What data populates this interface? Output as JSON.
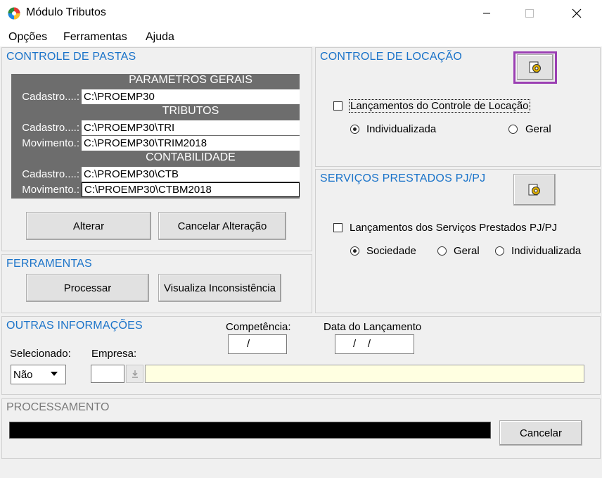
{
  "window": {
    "title": "Módulo Tributos"
  },
  "menu": {
    "items": [
      "Opções",
      "Ferramentas",
      "Ajuda"
    ]
  },
  "pastas": {
    "title": "CONTROLE DE PASTAS",
    "sections": [
      {
        "header": "PARAMETROS GERAIS",
        "rows": [
          {
            "label": "Cadastro....:",
            "path": "C:\\PROEMP30"
          }
        ]
      },
      {
        "header": "TRIBUTOS",
        "rows": [
          {
            "label": "Cadastro....:",
            "path": "C:\\PROEMP30\\TRI"
          },
          {
            "label": "Movimento.:",
            "path": "C:\\PROEMP30\\TRIM2018"
          }
        ]
      },
      {
        "header": "CONTABILIDADE",
        "rows": [
          {
            "label": "Cadastro....:",
            "path": "C:\\PROEMP30\\CTB"
          },
          {
            "label": "Movimento.:",
            "path": "C:\\PROEMP30\\CTBM2018"
          }
        ]
      }
    ],
    "alterar_label": "Alterar",
    "cancelar_alteracao_label": "Cancelar Alteração"
  },
  "ferramentas": {
    "title": "FERRAMENTAS",
    "processar_label": "Processar",
    "visualiza_label": "Visualiza Inconsistência"
  },
  "locacao": {
    "title": "CONTROLE DE LOCAÇÃO",
    "checkbox_label": "Lançamentos do Controle de Locação",
    "options": [
      "Individualizada",
      "Geral"
    ],
    "selected": "Individualizada"
  },
  "servicos": {
    "title": "SERVIÇOS PRESTADOS PJ/PJ",
    "checkbox_label": "Lançamentos dos Serviços Prestados PJ/PJ",
    "options": [
      "Sociedade",
      "Geral",
      "Individualizada"
    ],
    "selected": "Sociedade"
  },
  "outras": {
    "title": "OUTRAS INFORMAÇÕES",
    "competencia_label": "Competência:",
    "competencia_value": "/",
    "data_label": "Data do Lançamento",
    "data_value": "/    /",
    "selecionado_label": "Selecionado:",
    "selecionado_value": "Não",
    "empresa_label": "Empresa:",
    "empresa_value": "",
    "empresa_nome": ""
  },
  "processamento": {
    "title": "PROCESSAMENTO",
    "progress": 0,
    "cancelar_label": "Cancelar"
  }
}
